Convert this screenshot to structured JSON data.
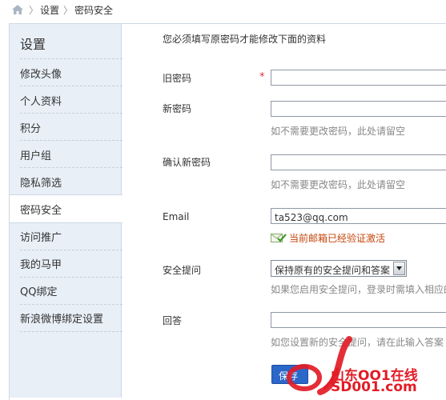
{
  "breadcrumb": {
    "home_icon": "home-icon",
    "sep1": "〉",
    "item1": "设置",
    "sep2": "〉",
    "item2": "密码安全"
  },
  "sidebar": {
    "title": "设置",
    "items": [
      {
        "label": "修改头像"
      },
      {
        "label": "个人资料"
      },
      {
        "label": "积分"
      },
      {
        "label": "用户组"
      },
      {
        "label": "隐私筛选"
      },
      {
        "label": "密码安全",
        "active": true
      },
      {
        "label": "访问推广"
      },
      {
        "label": "我的马甲"
      },
      {
        "label": "QQ绑定"
      },
      {
        "label": "新浪微博绑定设置"
      }
    ]
  },
  "form": {
    "notice": "您必须填写原密码才能修改下面的资料",
    "old_password": {
      "label": "旧密码",
      "required_mark": "*",
      "value": ""
    },
    "new_password": {
      "label": "新密码",
      "value": "",
      "hint": "如不需要更改密码，此处请留空"
    },
    "confirm_password": {
      "label": "确认新密码",
      "value": "",
      "hint": "如不需要更改密码，此处请留空"
    },
    "email": {
      "label": "Email",
      "value": "ta523@qq.com",
      "verified_text": "当前邮箱已经验证激活"
    },
    "security_question": {
      "label": "安全提问",
      "selected": "保持原有的安全提问和答案",
      "hint": "如果您启用安全提问，登录时需填入相应的"
    },
    "answer": {
      "label": "回答",
      "value": "",
      "hint": "如您设置新的安全提问，请在此输入答案"
    },
    "submit_label": "保存"
  },
  "watermark": {
    "line1": "山东OO1在线",
    "line2": "SD001.com"
  },
  "colors": {
    "sidebar_bg": "#e8eff7",
    "border": "#cfd8e4",
    "required": "#e03030",
    "verified": "#c5450a",
    "submit": "#2b67c9",
    "watermark": "#e21c26"
  }
}
